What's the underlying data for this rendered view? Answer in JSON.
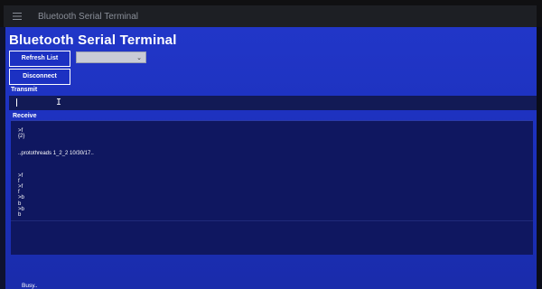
{
  "window": {
    "title": "Bluetooth Serial Terminal"
  },
  "app": {
    "title": "Bluetooth Serial Terminal",
    "refresh_label": "Refresh List",
    "disconnect_label": "Disconnect",
    "device_select": {
      "selected": "",
      "icon": "chevron-down-icon"
    }
  },
  "transmit": {
    "label": "Transmit",
    "value": ""
  },
  "receive": {
    "label": "Receive",
    "log": ">f\n{2}\n\n\n..protothreads 1_2_2 10/30/17..\n\n\n\n>f\nf\n>f\nf\n>b\nb\n>b\nb"
  },
  "status": {
    "text": "Busy.."
  }
}
